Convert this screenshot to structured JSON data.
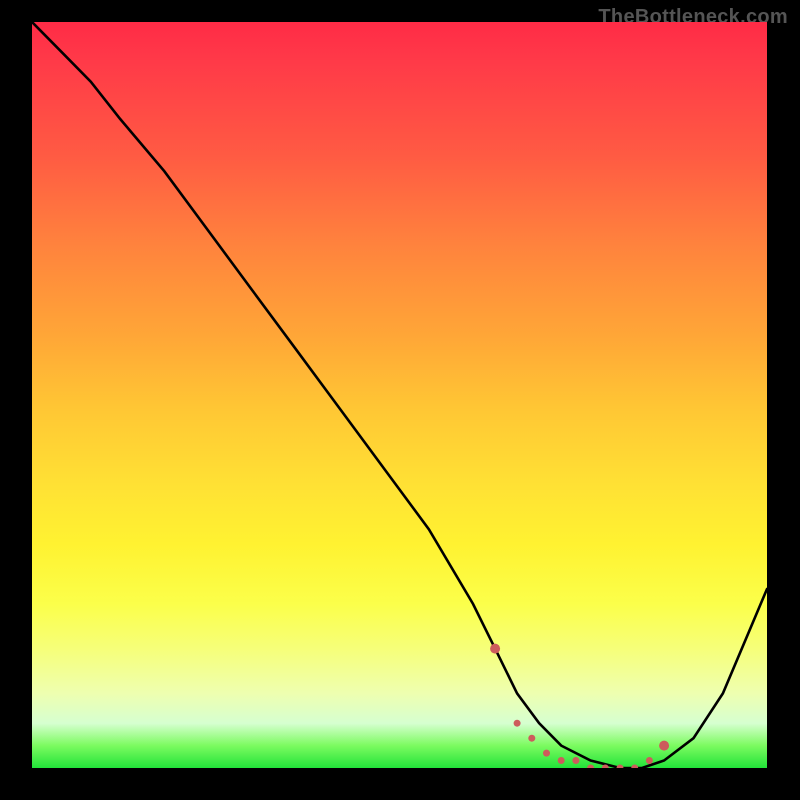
{
  "watermark": "TheBottleneck.com",
  "chart_data": {
    "type": "line",
    "title": "",
    "xlabel": "",
    "ylabel": "",
    "xlim": [
      0,
      100
    ],
    "ylim": [
      0,
      100
    ],
    "series": [
      {
        "name": "bottleneck-curve",
        "x": [
          0,
          4,
          8,
          12,
          18,
          24,
          30,
          36,
          42,
          48,
          54,
          60,
          63,
          66,
          69,
          72,
          76,
          80,
          83,
          86,
          90,
          94,
          100
        ],
        "values": [
          100,
          96,
          92,
          87,
          80,
          72,
          64,
          56,
          48,
          40,
          32,
          22,
          16,
          10,
          6,
          3,
          1,
          0,
          0,
          1,
          4,
          10,
          24
        ]
      }
    ],
    "markers": {
      "name": "bottom-dots",
      "color": "#cd5c5c",
      "x": [
        63,
        66,
        68,
        70,
        72,
        74,
        76,
        78,
        80,
        82,
        84,
        86
      ],
      "values": [
        16,
        6,
        4,
        2,
        1,
        1,
        0,
        0,
        0,
        0,
        1,
        3
      ]
    },
    "gradient_bands": [
      {
        "stop": 0,
        "color": "#ff2b46"
      },
      {
        "stop": 50,
        "color": "#ffca31"
      },
      {
        "stop": 80,
        "color": "#f9ff55"
      },
      {
        "stop": 100,
        "color": "#22e339"
      }
    ]
  }
}
